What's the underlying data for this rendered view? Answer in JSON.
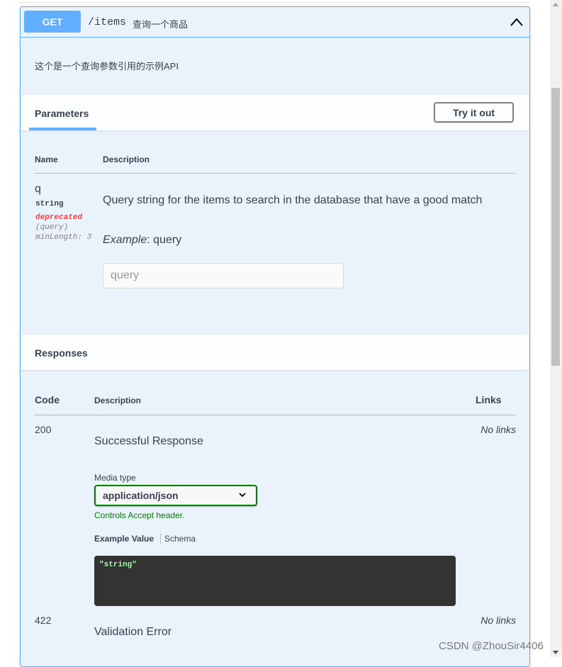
{
  "operation": {
    "method": "GET",
    "path": "/items",
    "summary": "查询一个商品",
    "description": "这个是一个查询参数引用的示例API"
  },
  "parameters": {
    "tab_title": "Parameters",
    "try_button": "Try it out",
    "col_name": "Name",
    "col_description": "Description",
    "items": [
      {
        "name": "q",
        "type": "string",
        "deprecated": "deprecated",
        "in": "(query)",
        "min_length": "minLength: 3",
        "description": "Query string for the items to search in the database that have a good match",
        "example_label": "Example",
        "example_value": ": query",
        "input_placeholder": "query"
      }
    ]
  },
  "responses": {
    "tab_title": "Responses",
    "col_code": "Code",
    "col_description": "Description",
    "col_links": "Links",
    "media_type_label": "Media type",
    "media_type_value": "application/json",
    "controls_note": "Controls Accept header.",
    "example_tab": "Example Value",
    "schema_tab": "Schema",
    "example_code": "\"string\"",
    "items": [
      {
        "code": "200",
        "description": "Successful Response",
        "links": "No links"
      },
      {
        "code": "422",
        "description": "Validation Error",
        "links": "No links"
      }
    ]
  },
  "watermark": "CSDN @ZhouSir4406",
  "colors": {
    "get_method": "#61affe",
    "opblock_bg": "#eaf3fb",
    "deprecated": "#f93e3e",
    "media_select_border": "#008000",
    "code_bg": "#333333",
    "code_text": "#a2fca2"
  }
}
